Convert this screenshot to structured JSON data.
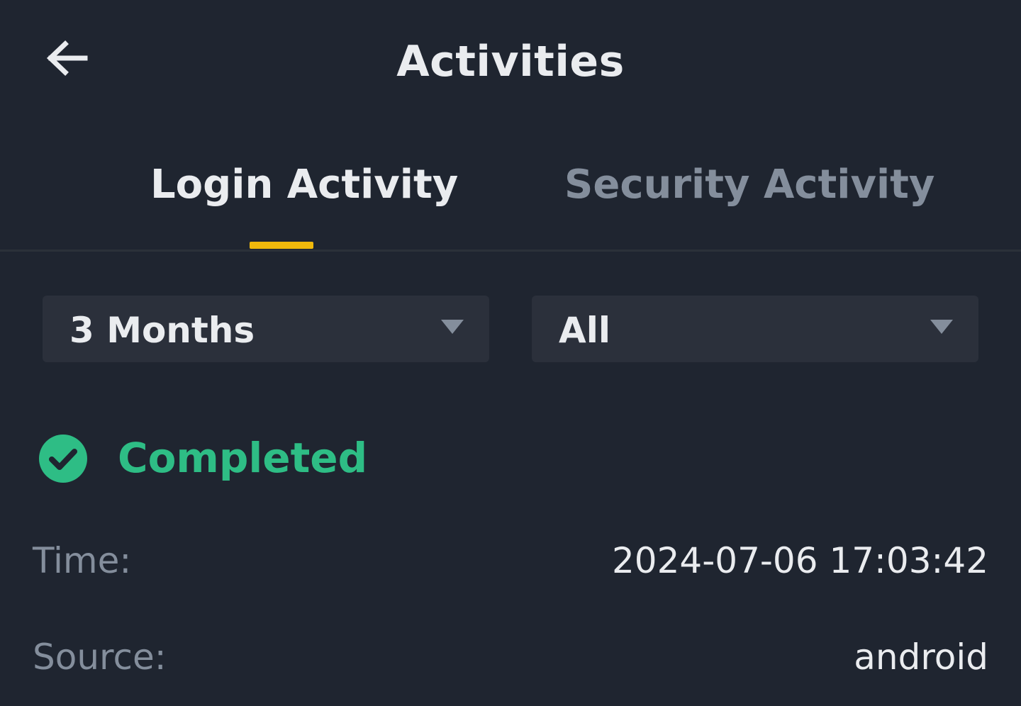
{
  "header": {
    "title": "Activities",
    "back_icon": "arrow-left-icon"
  },
  "tabs": [
    {
      "label": "Login Activity",
      "active": true
    },
    {
      "label": "Security Activity",
      "active": false
    }
  ],
  "filters": {
    "period": {
      "value": "3 Months",
      "icon": "caret-down-icon"
    },
    "type": {
      "value": "All",
      "icon": "caret-down-icon"
    }
  },
  "activity": {
    "status": "Completed",
    "status_icon": "check-circle-icon",
    "time_label": "Time:",
    "time_value": "2024-07-06 17:03:42",
    "source_label": "Source:",
    "source_value": "android"
  },
  "colors": {
    "background": "#1f2530",
    "accent": "#f0b90b",
    "success": "#2ebd85",
    "text_primary": "#eaecef",
    "text_secondary": "#848e9c"
  }
}
